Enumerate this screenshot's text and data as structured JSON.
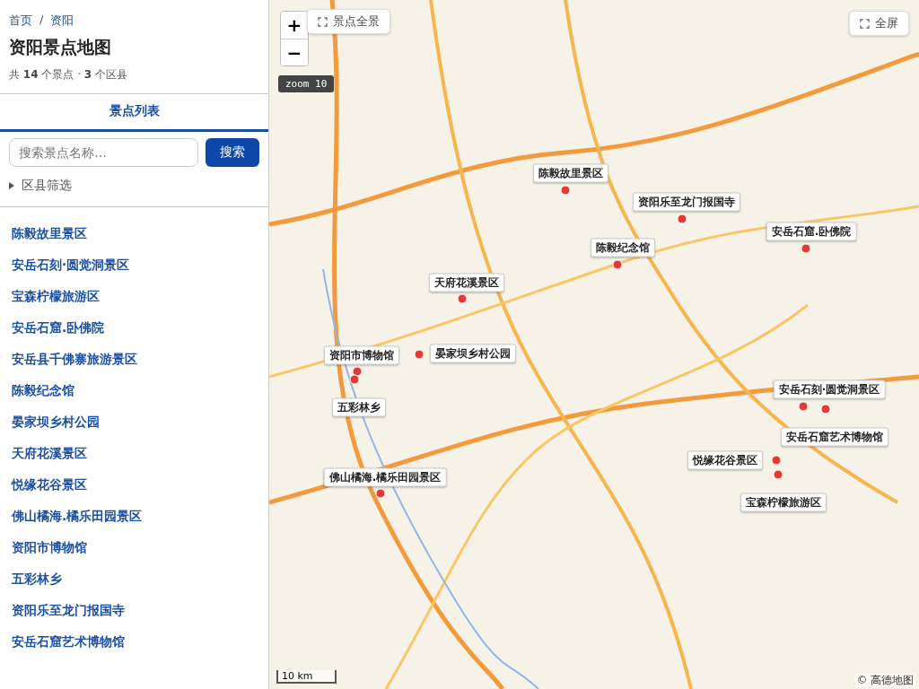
{
  "breadcrumb": [
    {
      "label": "首页"
    },
    {
      "label": "资阳"
    }
  ],
  "breadcrumb_separator": "/",
  "title": "资阳景点地图",
  "summary": "共 **14** 个景点 · **3** 个区县",
  "tabs": [
    {
      "label": "景点列表",
      "selected": true
    }
  ],
  "search": {
    "placeholder": "搜索景点名称…",
    "button": "搜索"
  },
  "filter": {
    "label": "区县筛选",
    "expanded": false
  },
  "spots": [
    "陈毅故里景区",
    "安岳石刻·圆觉洞景区",
    "宝森柠檬旅游区",
    "安岳石窟.卧佛院",
    "安岳县千佛寨旅游景区",
    "陈毅纪念馆",
    "晏家坝乡村公园",
    "天府花溪景区",
    "悦缘花谷景区",
    "佛山橘海.橘乐田园景区",
    "资阳市博物馆",
    "五彩林乡",
    "资阳乐至龙门报国寺",
    "安岳石窟艺术博物馆"
  ],
  "map": {
    "zoom_in": "+",
    "zoom_out": "−",
    "overview_button": "景点全景",
    "fullscreen_button": "全屏",
    "zoom_badge": "zoom 10",
    "scale": "10 km",
    "attribution": "© 高德地图",
    "markers": [
      {
        "label": "陈毅故里景区"
      },
      {
        "label": "资阳乐至龙门报国寺"
      },
      {
        "label": "安岳石窟.卧佛院"
      },
      {
        "label": "陈毅纪念馆"
      },
      {
        "label": "天府花溪景区"
      },
      {
        "label": "资阳市博物馆"
      },
      {
        "label": "晏家坝乡村公园"
      },
      {
        "label": "五彩林乡"
      },
      {
        "label": "安岳石刻·圆觉洞景区"
      },
      {
        "label": "安岳石窟艺术博物馆"
      },
      {
        "label": "悦缘花谷景区"
      },
      {
        "label": "宝森柠檬旅游区"
      },
      {
        "label": "佛山橘海.橘乐田园景区"
      }
    ]
  }
}
